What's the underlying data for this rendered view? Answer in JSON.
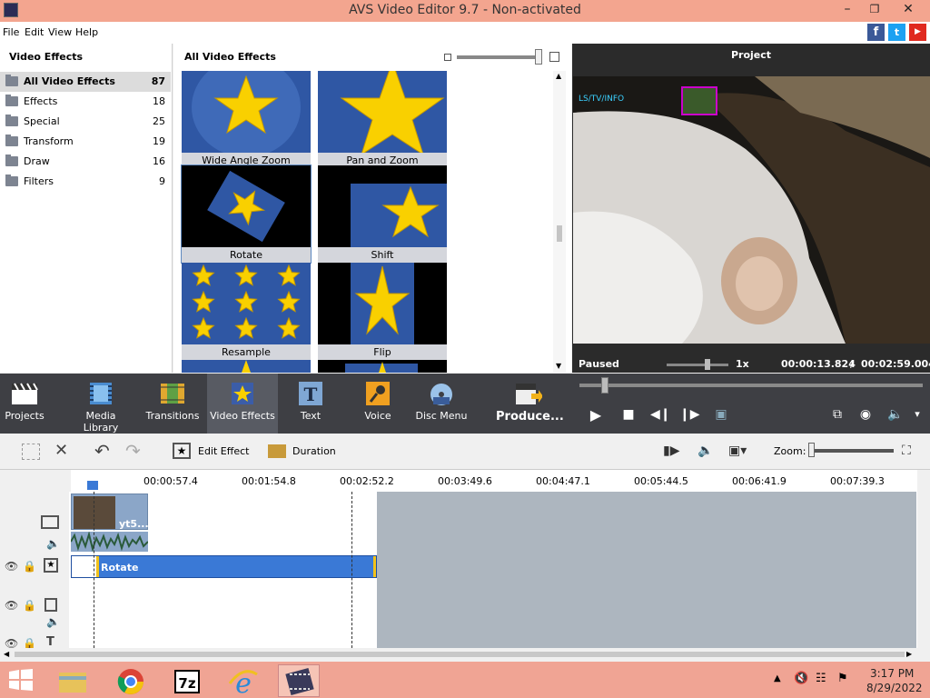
{
  "window": {
    "title": "AVS Video Editor 9.7 - Non-activated"
  },
  "menu": [
    "File",
    "Edit",
    "View",
    "Help"
  ],
  "social": [
    {
      "name": "f",
      "color": "#3b5998"
    },
    {
      "name": "t",
      "color": "#1da1f2"
    },
    {
      "name": "yt",
      "color": "#e02a20"
    }
  ],
  "left_panel": {
    "heading": "Video Effects",
    "categories": [
      {
        "label": "All Video Effects",
        "count": "87"
      },
      {
        "label": "Effects",
        "count": "18"
      },
      {
        "label": "Special",
        "count": "25"
      },
      {
        "label": "Transform",
        "count": "19"
      },
      {
        "label": "Draw",
        "count": "16"
      },
      {
        "label": "Filters",
        "count": "9"
      }
    ]
  },
  "mid_panel": {
    "heading": "All Video Effects",
    "effects": [
      {
        "label": "Wide Angle Zoom"
      },
      {
        "label": "Pan and Zoom"
      },
      {
        "label": "Rotate"
      },
      {
        "label": "Shift"
      },
      {
        "label": "Resample"
      },
      {
        "label": "Flip"
      }
    ]
  },
  "project_panel": {
    "heading": "Project",
    "status": "Paused",
    "speed": "1x",
    "current_time": "00:00:13.824",
    "separator": "/",
    "total_time": "00:02:59.004"
  },
  "toolbar": {
    "projects": "Projects",
    "media_library": "Media Library",
    "transitions": "Transitions",
    "video_effects": "Video Effects",
    "text": "Text",
    "voice": "Voice",
    "disc_menu": "Disc Menu",
    "produce": "Produce..."
  },
  "timeline_toolbar": {
    "edit_effect": "Edit Effect",
    "duration": "Duration",
    "zoom_label": "Zoom:"
  },
  "ruler": [
    "00:00:57.4",
    "00:01:54.8",
    "00:02:52.2",
    "00:03:49.6",
    "00:04:47.1",
    "00:05:44.5",
    "00:06:41.9",
    "00:07:39.3"
  ],
  "timeline": {
    "clip_label": "yt5...",
    "effect_label": "Rotate"
  },
  "taskbar": {
    "time": "3:17 PM",
    "date": "8/29/2022"
  },
  "colors": {
    "title_bg": "#f3a58f",
    "taskbar_bg": "#f0a494",
    "toolbar_bg": "#3e3f44",
    "effect_bar": "#3a79d6",
    "effect_edge": "#f2c21a",
    "star": "#f9d000",
    "tile_blue": "#2f57a4"
  }
}
